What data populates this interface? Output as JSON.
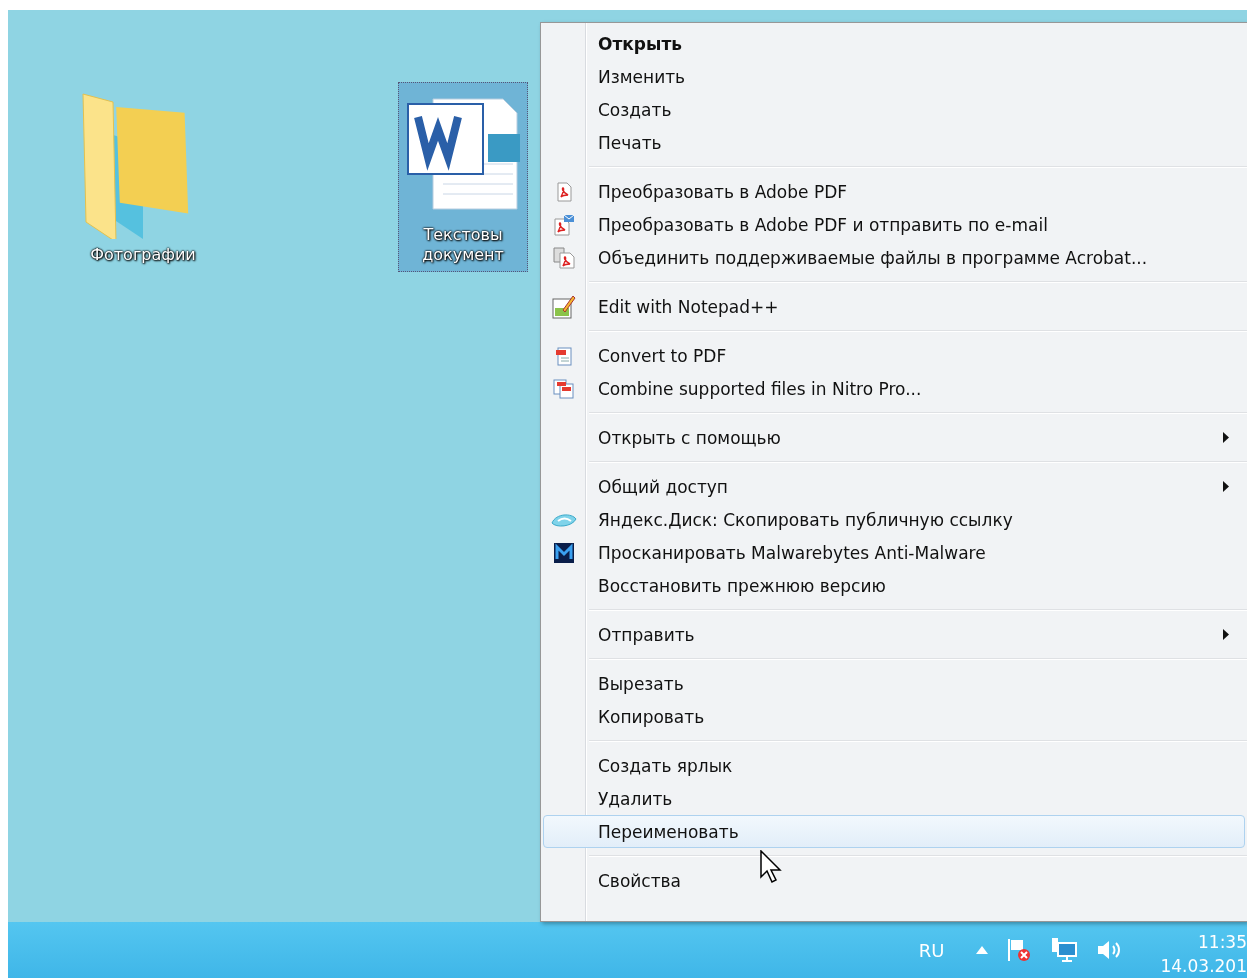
{
  "desktop": {
    "icons": [
      {
        "kind": "folder",
        "lines": [
          "Фотографии"
        ],
        "selected": false
      },
      {
        "kind": "word-document",
        "lines": [
          "Текстовы",
          "документ"
        ],
        "selected": true
      }
    ]
  },
  "context_menu": {
    "groups": [
      [
        {
          "label": "Открыть",
          "bold": true,
          "kind": "plain",
          "submenu": false,
          "selected": false
        },
        {
          "label": "Изменить",
          "bold": false,
          "kind": "plain",
          "submenu": false,
          "selected": false
        },
        {
          "label": "Создать",
          "bold": false,
          "kind": "plain",
          "submenu": false,
          "selected": false
        },
        {
          "label": "Печать",
          "bold": false,
          "kind": "plain",
          "submenu": false,
          "selected": false
        }
      ],
      [
        {
          "label": "Преобразовать в Adobe PDF",
          "bold": false,
          "kind": "pdf",
          "submenu": false,
          "selected": false
        },
        {
          "label": "Преобразовать в Adobe PDF и отправить по e-mail",
          "bold": false,
          "kind": "pdf-mail",
          "submenu": false,
          "selected": false
        },
        {
          "label": "Объединить поддерживаемые файлы в программе Acrobat...",
          "bold": false,
          "kind": "pdf-combine",
          "submenu": false,
          "selected": false
        }
      ],
      [
        {
          "label": "Edit with Notepad++",
          "bold": false,
          "kind": "notepad",
          "submenu": false,
          "selected": false
        }
      ],
      [
        {
          "label": "Convert to PDF",
          "bold": false,
          "kind": "nitro",
          "submenu": false,
          "selected": false
        },
        {
          "label": "Combine supported files in Nitro Pro...",
          "bold": false,
          "kind": "nitro-combine",
          "submenu": false,
          "selected": false
        }
      ],
      [
        {
          "label": "Открыть с помощью",
          "bold": false,
          "kind": "plain",
          "submenu": true,
          "selected": false
        }
      ],
      [
        {
          "label": "Общий доступ",
          "bold": false,
          "kind": "plain",
          "submenu": true,
          "selected": false
        },
        {
          "label": "Яндекс.Диск: Скопировать публичную ссылку",
          "bold": false,
          "kind": "cloud",
          "submenu": false,
          "selected": false
        },
        {
          "label": "Просканировать Malwarebytes Anti-Malware",
          "bold": false,
          "kind": "malware",
          "submenu": false,
          "selected": false
        },
        {
          "label": "Восстановить прежнюю версию",
          "bold": false,
          "kind": "plain",
          "submenu": false,
          "selected": false
        }
      ],
      [
        {
          "label": "Отправить",
          "bold": false,
          "kind": "plain",
          "submenu": true,
          "selected": false
        }
      ],
      [
        {
          "label": "Вырезать",
          "bold": false,
          "kind": "plain",
          "submenu": false,
          "selected": false
        },
        {
          "label": "Копировать",
          "bold": false,
          "kind": "plain",
          "submenu": false,
          "selected": false
        }
      ],
      [
        {
          "label": "Создать ярлык",
          "bold": false,
          "kind": "plain",
          "submenu": false,
          "selected": false
        },
        {
          "label": "Удалить",
          "bold": false,
          "kind": "plain",
          "submenu": false,
          "selected": false
        },
        {
          "label": "Переименовать",
          "bold": false,
          "kind": "plain",
          "submenu": false,
          "selected": true
        }
      ],
      [
        {
          "label": "Свойства",
          "bold": false,
          "kind": "plain",
          "submenu": false,
          "selected": false
        }
      ]
    ]
  },
  "taskbar": {
    "language": "RU",
    "time": "11:35",
    "date": "14.03.201"
  }
}
